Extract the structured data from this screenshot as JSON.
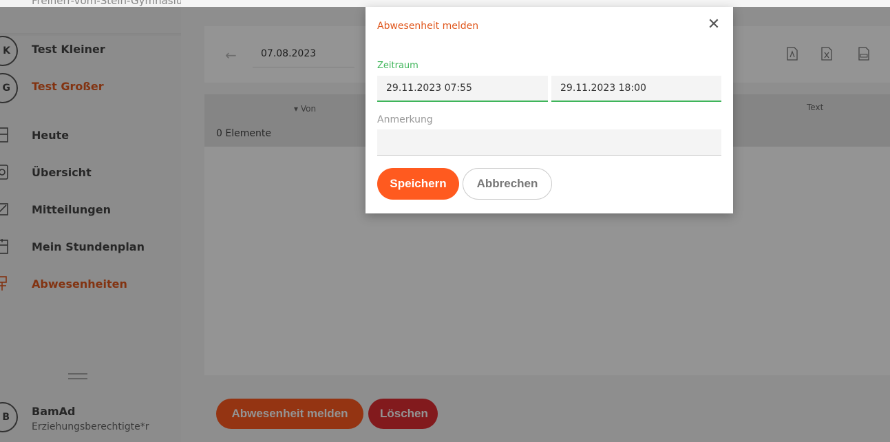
{
  "sidebar": {
    "school": "Freiherr-vom-Stein-Gymnasium",
    "children": [
      {
        "initial": "K",
        "name": "Test Kleiner",
        "active": false
      },
      {
        "initial": "G",
        "name": "Test Großer",
        "active": true
      }
    ],
    "nav": [
      {
        "icon": "calendar-day-icon",
        "label": "Heute"
      },
      {
        "icon": "overview-icon",
        "label": "Übersicht"
      },
      {
        "icon": "message-icon",
        "label": "Mitteilungen"
      },
      {
        "icon": "timetable-icon",
        "label": "Mein Stundenplan"
      },
      {
        "icon": "absence-icon",
        "label": "Abwesenheiten"
      }
    ],
    "menu_icon": "hamburger-icon",
    "user": {
      "initial": "B",
      "name": "BamAd",
      "role": "Erziehungsberechtigte*r"
    }
  },
  "toolbar": {
    "back_icon": "arrow-left-icon",
    "date": "07.08.2023",
    "exports": [
      "pdf-icon",
      "excel-icon",
      "csv-icon"
    ]
  },
  "grid": {
    "columns": {
      "von": "Von",
      "text": "Text"
    },
    "sort_icon": "sort-down-icon",
    "count": "0 Elemente"
  },
  "footer": {
    "report_button": "Abwesenheit melden",
    "delete_button": "Löschen"
  },
  "modal": {
    "title": "Abwesenheit melden",
    "close_icon": "close-icon",
    "range_label": "Zeitraum",
    "from": "29.11.2023 07:55",
    "to": "29.11.2023 18:00",
    "note_label": "Anmerkung",
    "note": "",
    "save_button": "Speichern",
    "cancel_button": "Abbrechen"
  },
  "colors": {
    "accent": "#ff5a1f",
    "danger": "#e02d33",
    "focus": "#3fb55a",
    "active_text": "#e0581e"
  }
}
